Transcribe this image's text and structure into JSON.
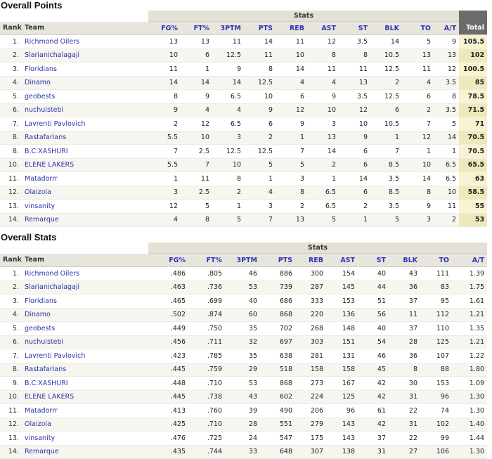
{
  "points_section": {
    "title": "Overall Points",
    "group_label": "Stats",
    "columns": {
      "rank": "Rank",
      "team": "Team",
      "fg": "FG%",
      "ft": "FT%",
      "tpm": "3PTM",
      "pts": "PTS",
      "reb": "REB",
      "ast": "AST",
      "st": "ST",
      "blk": "BLK",
      "to": "TO",
      "at": "A/T",
      "total": "Total"
    },
    "rows": [
      {
        "rank": "1.",
        "team": "Richmond Oilers",
        "fg": "13",
        "ft": "13",
        "tpm": "11",
        "pts": "14",
        "reb": "11",
        "ast": "12",
        "st": "3.5",
        "blk": "14",
        "to": "5",
        "at": "9",
        "total": "105.5"
      },
      {
        "rank": "2.",
        "team": "Slarianichalagaji",
        "fg": "10",
        "ft": "6",
        "tpm": "12.5",
        "pts": "11",
        "reb": "10",
        "ast": "8",
        "st": "8",
        "blk": "10.5",
        "to": "13",
        "at": "13",
        "total": "102"
      },
      {
        "rank": "3.",
        "team": "Floridians",
        "fg": "11",
        "ft": "1",
        "tpm": "9",
        "pts": "8",
        "reb": "14",
        "ast": "11",
        "st": "11",
        "blk": "12.5",
        "to": "11",
        "at": "12",
        "total": "100.5"
      },
      {
        "rank": "4.",
        "team": "Dinamo",
        "fg": "14",
        "ft": "14",
        "tpm": "14",
        "pts": "12.5",
        "reb": "4",
        "ast": "4",
        "st": "13",
        "blk": "2",
        "to": "4",
        "at": "3.5",
        "total": "85"
      },
      {
        "rank": "5.",
        "team": "geobests",
        "fg": "8",
        "ft": "9",
        "tpm": "6.5",
        "pts": "10",
        "reb": "6",
        "ast": "9",
        "st": "3.5",
        "blk": "12.5",
        "to": "6",
        "at": "8",
        "total": "78.5"
      },
      {
        "rank": "6.",
        "team": "nuchuistebi",
        "fg": "9",
        "ft": "4",
        "tpm": "4",
        "pts": "9",
        "reb": "12",
        "ast": "10",
        "st": "12",
        "blk": "6",
        "to": "2",
        "at": "3.5",
        "total": "71.5"
      },
      {
        "rank": "7.",
        "team": "Lavrenti Pavlovich",
        "fg": "2",
        "ft": "12",
        "tpm": "6.5",
        "pts": "6",
        "reb": "9",
        "ast": "3",
        "st": "10",
        "blk": "10.5",
        "to": "7",
        "at": "5",
        "total": "71"
      },
      {
        "rank": "8.",
        "team": "Rastafarians",
        "fg": "5.5",
        "ft": "10",
        "tpm": "3",
        "pts": "2",
        "reb": "1",
        "ast": "13",
        "st": "9",
        "blk": "1",
        "to": "12",
        "at": "14",
        "total": "70.5"
      },
      {
        "rank": "8.",
        "team": "B.C.XASHURI",
        "fg": "7",
        "ft": "2.5",
        "tpm": "12.5",
        "pts": "12.5",
        "reb": "7",
        "ast": "14",
        "st": "6",
        "blk": "7",
        "to": "1",
        "at": "1",
        "total": "70.5"
      },
      {
        "rank": "10.",
        "team": "ELENE LAKERS",
        "fg": "5.5",
        "ft": "7",
        "tpm": "10",
        "pts": "5",
        "reb": "5",
        "ast": "2",
        "st": "6",
        "blk": "8.5",
        "to": "10",
        "at": "6.5",
        "total": "65.5"
      },
      {
        "rank": "11.",
        "team": "Matadorrr",
        "fg": "1",
        "ft": "11",
        "tpm": "8",
        "pts": "1",
        "reb": "3",
        "ast": "1",
        "st": "14",
        "blk": "3.5",
        "to": "14",
        "at": "6.5",
        "total": "63"
      },
      {
        "rank": "12.",
        "team": "Olaizola",
        "fg": "3",
        "ft": "2.5",
        "tpm": "2",
        "pts": "4",
        "reb": "8",
        "ast": "6.5",
        "st": "6",
        "blk": "8.5",
        "to": "8",
        "at": "10",
        "total": "58.5"
      },
      {
        "rank": "13.",
        "team": "vinsanity",
        "fg": "12",
        "ft": "5",
        "tpm": "1",
        "pts": "3",
        "reb": "2",
        "ast": "6.5",
        "st": "2",
        "blk": "3.5",
        "to": "9",
        "at": "11",
        "total": "55"
      },
      {
        "rank": "14.",
        "team": "Remarque",
        "fg": "4",
        "ft": "8",
        "tpm": "5",
        "pts": "7",
        "reb": "13",
        "ast": "5",
        "st": "1",
        "blk": "5",
        "to": "3",
        "at": "2",
        "total": "53"
      }
    ]
  },
  "stats_section": {
    "title": "Overall Stats",
    "group_label": "Stats",
    "columns": {
      "rank": "Rank",
      "team": "Team",
      "fg": "FG%",
      "ft": "FT%",
      "tpm": "3PTM",
      "pts": "PTS",
      "reb": "REB",
      "ast": "AST",
      "st": "ST",
      "blk": "BLK",
      "to": "TO",
      "at": "A/T"
    },
    "rows": [
      {
        "rank": "1.",
        "team": "Richmond Oilers",
        "fg": ".486",
        "ft": ".805",
        "tpm": "46",
        "pts": "886",
        "reb": "300",
        "ast": "154",
        "st": "40",
        "blk": "43",
        "to": "111",
        "at": "1.39"
      },
      {
        "rank": "2.",
        "team": "Slarianichalagaji",
        "fg": ".463",
        "ft": ".736",
        "tpm": "53",
        "pts": "739",
        "reb": "287",
        "ast": "145",
        "st": "44",
        "blk": "36",
        "to": "83",
        "at": "1.75"
      },
      {
        "rank": "3.",
        "team": "Floridians",
        "fg": ".465",
        "ft": ".699",
        "tpm": "40",
        "pts": "686",
        "reb": "333",
        "ast": "153",
        "st": "51",
        "blk": "37",
        "to": "95",
        "at": "1.61"
      },
      {
        "rank": "4.",
        "team": "Dinamo",
        "fg": ".502",
        "ft": ".874",
        "tpm": "60",
        "pts": "868",
        "reb": "220",
        "ast": "136",
        "st": "56",
        "blk": "11",
        "to": "112",
        "at": "1.21"
      },
      {
        "rank": "5.",
        "team": "geobests",
        "fg": ".449",
        "ft": ".750",
        "tpm": "35",
        "pts": "702",
        "reb": "268",
        "ast": "148",
        "st": "40",
        "blk": "37",
        "to": "110",
        "at": "1.35"
      },
      {
        "rank": "6.",
        "team": "nuchuistebi",
        "fg": ".456",
        "ft": ".711",
        "tpm": "32",
        "pts": "697",
        "reb": "303",
        "ast": "151",
        "st": "54",
        "blk": "28",
        "to": "125",
        "at": "1.21"
      },
      {
        "rank": "7.",
        "team": "Lavrenti Pavlovich",
        "fg": ".423",
        "ft": ".785",
        "tpm": "35",
        "pts": "638",
        "reb": "281",
        "ast": "131",
        "st": "46",
        "blk": "36",
        "to": "107",
        "at": "1.22"
      },
      {
        "rank": "8.",
        "team": "Rastafarians",
        "fg": ".445",
        "ft": ".759",
        "tpm": "29",
        "pts": "518",
        "reb": "158",
        "ast": "158",
        "st": "45",
        "blk": "8",
        "to": "88",
        "at": "1.80"
      },
      {
        "rank": "9.",
        "team": "B.C.XASHURI",
        "fg": ".448",
        "ft": ".710",
        "tpm": "53",
        "pts": "868",
        "reb": "273",
        "ast": "167",
        "st": "42",
        "blk": "30",
        "to": "153",
        "at": "1.09"
      },
      {
        "rank": "10.",
        "team": "ELENE LAKERS",
        "fg": ".445",
        "ft": ".738",
        "tpm": "43",
        "pts": "602",
        "reb": "224",
        "ast": "125",
        "st": "42",
        "blk": "31",
        "to": "96",
        "at": "1.30"
      },
      {
        "rank": "11.",
        "team": "Matadorrr",
        "fg": ".413",
        "ft": ".760",
        "tpm": "39",
        "pts": "490",
        "reb": "206",
        "ast": "96",
        "st": "61",
        "blk": "22",
        "to": "74",
        "at": "1.30"
      },
      {
        "rank": "12.",
        "team": "Olaizola",
        "fg": ".425",
        "ft": ".710",
        "tpm": "28",
        "pts": "551",
        "reb": "279",
        "ast": "143",
        "st": "42",
        "blk": "31",
        "to": "102",
        "at": "1.40"
      },
      {
        "rank": "13.",
        "team": "vinsanity",
        "fg": ".476",
        "ft": ".725",
        "tpm": "24",
        "pts": "547",
        "reb": "175",
        "ast": "143",
        "st": "37",
        "blk": "22",
        "to": "99",
        "at": "1.44"
      },
      {
        "rank": "14.",
        "team": "Remarque",
        "fg": ".435",
        "ft": ".744",
        "tpm": "33",
        "pts": "648",
        "reb": "307",
        "ast": "138",
        "st": "31",
        "blk": "27",
        "to": "106",
        "at": "1.30"
      }
    ]
  },
  "colors": {
    "link": "#2c34a9",
    "header_bg": "#e8e6dc",
    "total_bg": "#6b6b6b",
    "total_cell": "#f8f3d0"
  }
}
